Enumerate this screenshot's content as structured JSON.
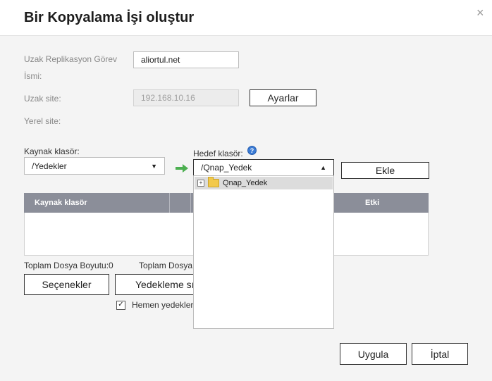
{
  "dialog": {
    "title": "Bir Kopyalama İşi oluştur",
    "close_icon": "×"
  },
  "form": {
    "job_name_label_line1": "Uzak Replikasyon Görev",
    "job_name_label_line2": "İsmi:",
    "job_name_value": "aliortul.net",
    "remote_site_label": "Uzak site:",
    "remote_site_value": "192.168.10.16",
    "settings_button": "Ayarlar",
    "local_site_label": "Yerel site:",
    "source_label": "Kaynak klasör:",
    "source_value": "/Yedekler",
    "dest_label": "Hedef klasör:",
    "dest_value": "/Qnap_Yedek",
    "add_button": "Ekle"
  },
  "tree": {
    "items": [
      {
        "label": "Qnap_Yedek",
        "expand": "+"
      }
    ]
  },
  "table": {
    "columns": [
      "Kaynak klasör",
      "Etki"
    ]
  },
  "summary": {
    "total_size": "Toplam Dosya Boyutu:0",
    "total_files": "Toplam Dosya"
  },
  "buttons": {
    "options": "Seçenekler",
    "backup_freq": "Yedekleme sı",
    "apply": "Uygula",
    "cancel": "İptal"
  },
  "checkbox": {
    "label": "Hemen yedekler",
    "checked": true
  },
  "colors": {
    "table_header": "#8b8e99",
    "arrow": "#4caf50",
    "help": "#3a7bd5"
  }
}
